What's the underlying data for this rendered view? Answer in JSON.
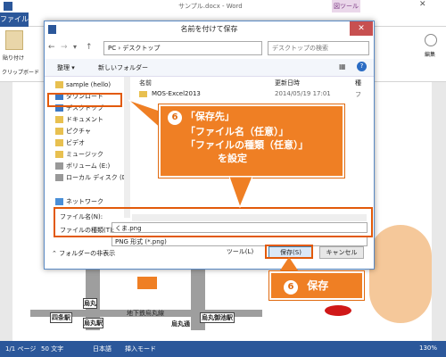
{
  "word": {
    "title": "サンプル.docx - Word",
    "tool_tab": "図ツール",
    "file_tab": "ファイル",
    "paste_label": "貼り付け",
    "clipboard_label": "クリップボード",
    "edit_label": "編集",
    "status": {
      "page": "1/1 ページ",
      "words": "50 文字",
      "lang": "日本語",
      "mode": "挿入モード",
      "zoom": "130%"
    },
    "map_labels": {
      "station1": "四条駅",
      "karasuma": "烏丸",
      "karasuma_eki": "烏丸駅",
      "subway": "地下鉄烏丸線",
      "karasuma_dori": "烏丸通",
      "karasuma_oike": "烏丸御池駅"
    }
  },
  "dialog": {
    "title": "名前を付けて保存",
    "close": "✕",
    "address": "PC › デスクトップ",
    "search_placeholder": "デスクトップの検索",
    "organize": "整理 ▾",
    "new_folder": "新しいフォルダー",
    "nav_items": [
      {
        "label": "sample (hello)",
        "icon": "user-folder-icon"
      },
      {
        "label": "ダウンロード",
        "icon": "download-folder-icon"
      },
      {
        "label": "デスクトップ",
        "icon": "desktop-folder-icon"
      },
      {
        "label": "ドキュメント",
        "icon": "documents-folder-icon"
      },
      {
        "label": "ピクチャ",
        "icon": "pictures-folder-icon"
      },
      {
        "label": "ビデオ",
        "icon": "videos-folder-icon"
      },
      {
        "label": "ミュージック",
        "icon": "music-folder-icon"
      },
      {
        "label": "ボリューム (E:)",
        "icon": "drive-icon"
      },
      {
        "label": "ローカル ディスク (D",
        "icon": "drive-icon"
      },
      {
        "label": "ネットワーク",
        "icon": "network-icon"
      }
    ],
    "columns": {
      "name": "名前",
      "modified": "更新日時",
      "type": "種"
    },
    "files": [
      {
        "name": "MOS-Excel2013",
        "modified": "2014/05/19 17:01",
        "type": "フ"
      }
    ],
    "filename_label": "ファイル名(N):",
    "filename_value": "くま.png",
    "filetype_label": "ファイルの種類(T):",
    "filetype_value": "PNG 形式 (*.png)",
    "hide_folders": "フォルダーの非表示",
    "tools": "ツール(L)",
    "save": "保存(S)",
    "cancel": "キャンセル"
  },
  "callouts": {
    "step_number": "6",
    "callout1_lines": [
      "「保存先」",
      "「ファイル名（任意）」",
      "「ファイルの種類（任意）」",
      "を設定"
    ],
    "callout2_text": "保存"
  },
  "colors": {
    "accent": "#ef7f24",
    "word_blue": "#2b579a",
    "highlight": "#e25a0a"
  }
}
